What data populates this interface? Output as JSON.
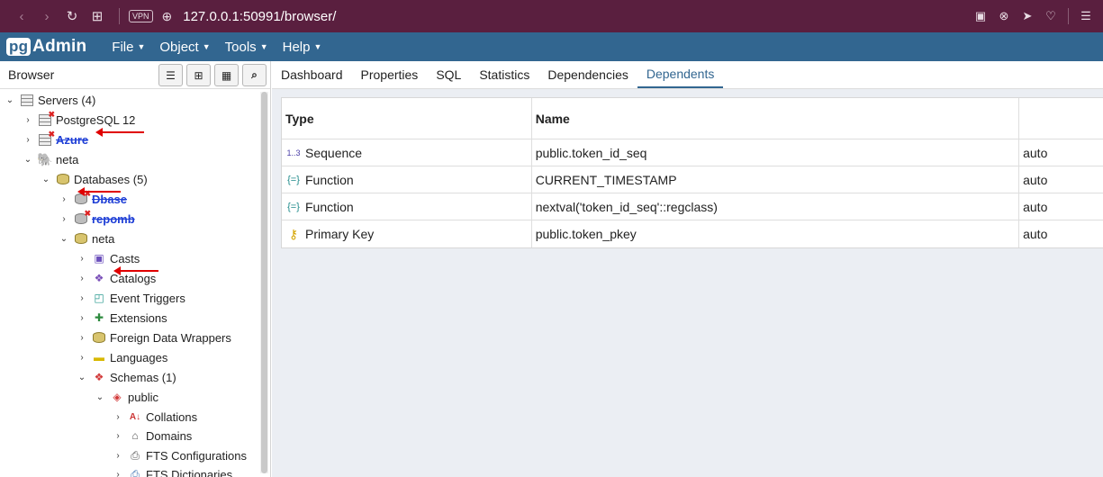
{
  "browser": {
    "url": "127.0.0.1:50991/browser/",
    "vpn_label": "VPN"
  },
  "app": {
    "logo_pg": "pg",
    "logo_text": "Admin",
    "menu": [
      {
        "label": "File"
      },
      {
        "label": "Object"
      },
      {
        "label": "Tools"
      },
      {
        "label": "Help"
      }
    ]
  },
  "sidebar": {
    "title": "Browser",
    "tree": [
      {
        "label": "Servers (4)",
        "icon": "servers-icon"
      },
      {
        "label": "PostgreSQL 12",
        "icon": "server-disconnected-icon"
      },
      {
        "label": "Azure",
        "icon": "server-disconnected-icon"
      },
      {
        "label": "neta",
        "icon": "postgres-elephant-icon"
      },
      {
        "label": "Databases (5)",
        "icon": "databases-icon"
      },
      {
        "label": "Dbase",
        "icon": "database-disconnected-icon"
      },
      {
        "label": "repomb",
        "icon": "database-disconnected-icon"
      },
      {
        "label": "neta",
        "icon": "database-icon"
      },
      {
        "label": "Casts",
        "icon": "casts-icon"
      },
      {
        "label": "Catalogs",
        "icon": "catalogs-icon"
      },
      {
        "label": "Event Triggers",
        "icon": "event-triggers-icon"
      },
      {
        "label": "Extensions",
        "icon": "extensions-icon"
      },
      {
        "label": "Foreign Data Wrappers",
        "icon": "foreign-data-wrappers-icon"
      },
      {
        "label": "Languages",
        "icon": "languages-icon"
      },
      {
        "label": "Schemas (1)",
        "icon": "schemas-icon"
      },
      {
        "label": "public",
        "icon": "schema-icon"
      },
      {
        "label": "Collations",
        "icon": "collations-icon"
      },
      {
        "label": "Domains",
        "icon": "domains-icon"
      },
      {
        "label": "FTS Configurations",
        "icon": "fts-configurations-icon"
      },
      {
        "label": "FTS Dictionaries",
        "icon": "fts-dictionaries-icon"
      }
    ]
  },
  "tabs": [
    {
      "label": "Dashboard"
    },
    {
      "label": "Properties"
    },
    {
      "label": "SQL"
    },
    {
      "label": "Statistics"
    },
    {
      "label": "Dependencies"
    },
    {
      "label": "Dependents"
    }
  ],
  "table": {
    "headers": [
      "Type",
      "Name",
      ""
    ],
    "rows": [
      {
        "type": "Sequence",
        "name": "public.token_id_seq",
        "restriction": "auto",
        "icon_glyph": "1..3"
      },
      {
        "type": "Function",
        "name": "CURRENT_TIMESTAMP",
        "restriction": "auto",
        "icon_glyph": "{=}"
      },
      {
        "type": "Function",
        "name": "nextval('token_id_seq'::regclass)",
        "restriction": "auto",
        "icon_glyph": "{=}"
      },
      {
        "type": "Primary Key",
        "name": "public.token_pkey",
        "restriction": "auto",
        "icon_glyph": "⚷"
      }
    ]
  },
  "colors": {
    "chrome": "#5a1f3f",
    "navbar": "#326690",
    "accent": "#326690",
    "annotation_arrow": "#e00000"
  }
}
